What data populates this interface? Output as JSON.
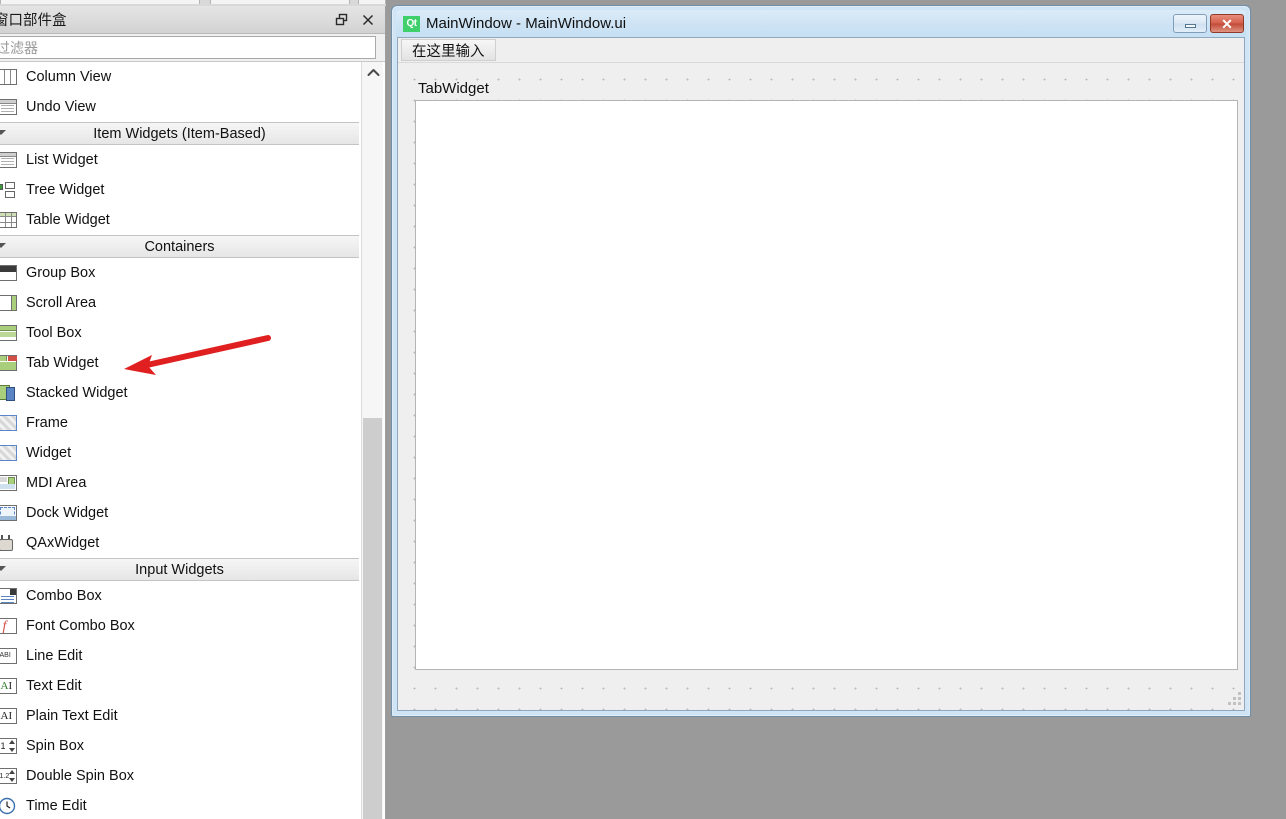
{
  "dock": {
    "title": "窗口部件盒",
    "float_icon": "restore-icon",
    "close_icon": "close-icon",
    "filter": {
      "value": "",
      "placeholder": "过滤器"
    },
    "scroll_up_icon": "chevron-up-icon"
  },
  "widget_list": [
    {
      "type": "item",
      "label": "Column View",
      "icon": "column-view-icon"
    },
    {
      "type": "item",
      "label": "Undo View",
      "icon": "undo-view-icon"
    },
    {
      "type": "section",
      "label": "Item Widgets (Item-Based)"
    },
    {
      "type": "item",
      "label": "List Widget",
      "icon": "list-widget-icon"
    },
    {
      "type": "item",
      "label": "Tree Widget",
      "icon": "tree-widget-icon"
    },
    {
      "type": "item",
      "label": "Table Widget",
      "icon": "table-widget-icon"
    },
    {
      "type": "section",
      "label": "Containers"
    },
    {
      "type": "item",
      "label": "Group Box",
      "icon": "group-box-icon"
    },
    {
      "type": "item",
      "label": "Scroll Area",
      "icon": "scroll-area-icon"
    },
    {
      "type": "item",
      "label": "Tool Box",
      "icon": "tool-box-icon"
    },
    {
      "type": "item",
      "label": "Tab Widget",
      "icon": "tab-widget-icon"
    },
    {
      "type": "item",
      "label": "Stacked Widget",
      "icon": "stacked-widget-icon"
    },
    {
      "type": "item",
      "label": "Frame",
      "icon": "frame-icon"
    },
    {
      "type": "item",
      "label": "Widget",
      "icon": "widget-icon"
    },
    {
      "type": "item",
      "label": "MDI Area",
      "icon": "mdi-area-icon"
    },
    {
      "type": "item",
      "label": "Dock Widget",
      "icon": "dock-widget-icon"
    },
    {
      "type": "item",
      "label": "QAxWidget",
      "icon": "qax-widget-icon"
    },
    {
      "type": "section",
      "label": "Input Widgets"
    },
    {
      "type": "item",
      "label": "Combo Box",
      "icon": "combo-box-icon"
    },
    {
      "type": "item",
      "label": "Font Combo Box",
      "icon": "font-combo-box-icon"
    },
    {
      "type": "item",
      "label": "Line Edit",
      "icon": "line-edit-icon"
    },
    {
      "type": "item",
      "label": "Text Edit",
      "icon": "text-edit-icon"
    },
    {
      "type": "item",
      "label": "Plain Text Edit",
      "icon": "plain-text-edit-icon"
    },
    {
      "type": "item",
      "label": "Spin Box",
      "icon": "spin-box-icon"
    },
    {
      "type": "item",
      "label": "Double Spin Box",
      "icon": "double-spin-box-icon"
    },
    {
      "type": "item",
      "label": "Time Edit",
      "icon": "time-edit-icon"
    }
  ],
  "main_window": {
    "app_icon_text": "Qt",
    "title": "MainWindow - MainWindow.ui",
    "minimize_label": "",
    "close_label": "✕",
    "menubar": {
      "placeholder_item": "在这里输入"
    },
    "form": {
      "tabwidget": {
        "tab_label": "TabWidget"
      }
    }
  },
  "annotation": {
    "arrow_color": "#e02020",
    "points_at": "Tab Widget"
  },
  "colors": {
    "window_border": "#cfe4f5",
    "desktop_background": "#9a9a9a",
    "close_button": "#c14a37",
    "qt_green": "#3fcf6b",
    "scrollbar_thumb": "#cdcdcd"
  }
}
